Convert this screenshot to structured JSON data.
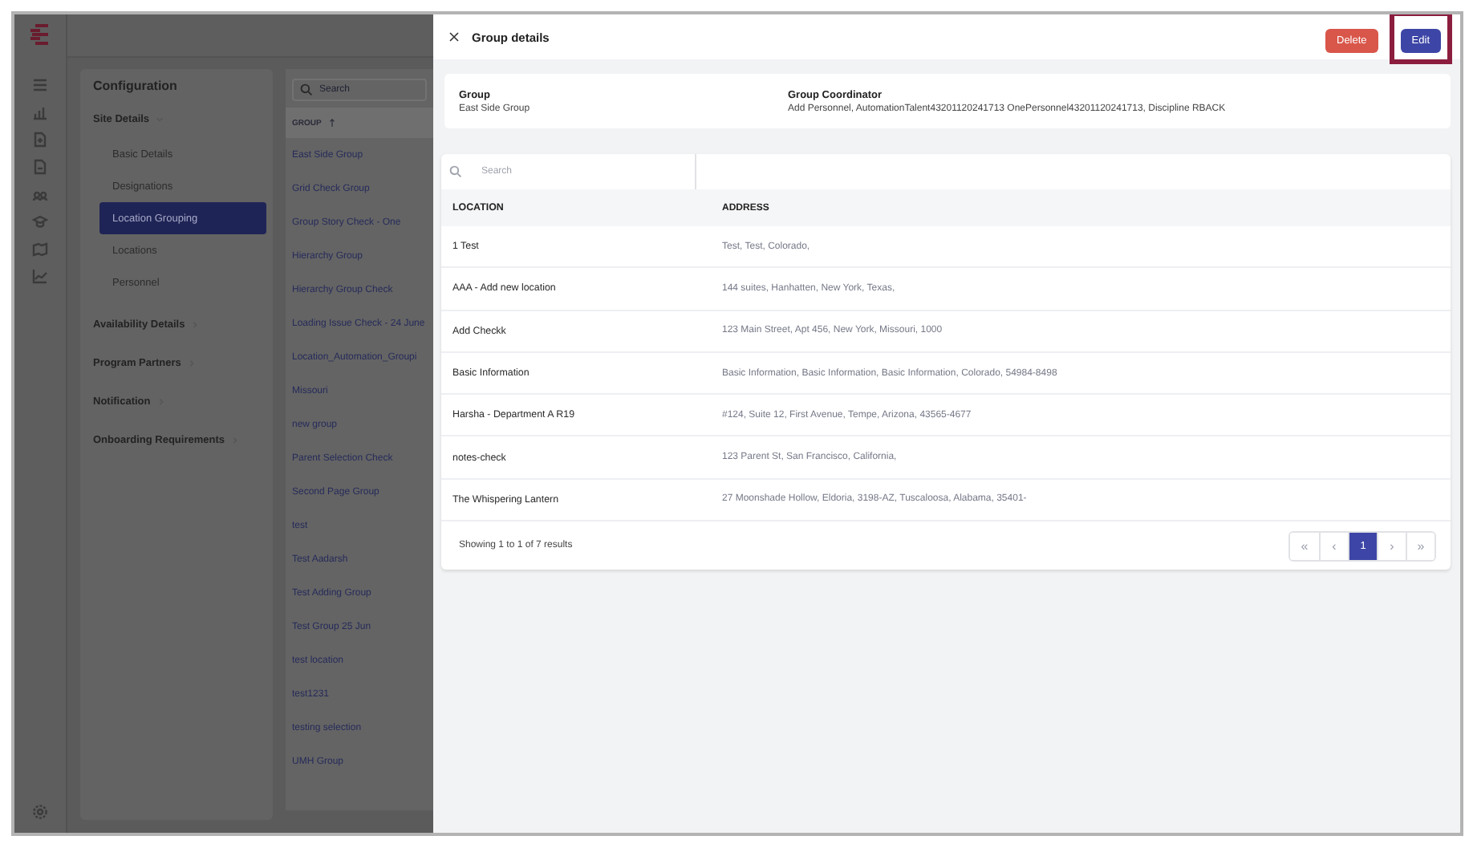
{
  "configuration": {
    "title": "Configuration",
    "sections": [
      {
        "label": "Site Details",
        "expanded": true,
        "items": [
          {
            "label": "Basic Details",
            "selected": false
          },
          {
            "label": "Designations",
            "selected": false
          },
          {
            "label": "Location Grouping",
            "selected": true
          },
          {
            "label": "Locations",
            "selected": false
          },
          {
            "label": "Personnel",
            "selected": false
          }
        ]
      },
      {
        "label": "Availability Details",
        "expanded": false
      },
      {
        "label": "Program Partners",
        "expanded": false
      },
      {
        "label": "Notification",
        "expanded": false
      },
      {
        "label": "Onboarding Requirements",
        "expanded": false
      }
    ]
  },
  "group_list": {
    "search": {
      "placeholder": "Search"
    },
    "column": "GROUP",
    "rows": [
      "East Side Group",
      "Grid Check Group",
      "Group Story Check - One",
      "Hierarchy Group",
      "Hierarchy Group Check",
      "Loading Issue Check - 24 June",
      "Location_Automation_Groupi",
      "Missouri",
      "new group",
      "Parent Selection Check",
      "Second Page Group",
      "test",
      "Test Aadarsh",
      "Test Adding Group",
      "Test Group 25 Jun",
      "test location",
      "test1231",
      "testing selection",
      "UMH Group"
    ]
  },
  "drawer": {
    "title": "Group details",
    "buttons": [
      {
        "label": "Delete",
        "kind": "danger",
        "highlighted": false
      },
      {
        "label": "Edit",
        "kind": "primary",
        "highlighted": true
      }
    ],
    "summary": [
      {
        "label": "Group",
        "value": "East Side Group"
      },
      {
        "label": "Group Coordinator",
        "value": "Add Personnel, AutomationTalent43201120241713 OnePersonnel43201120241713, Discipline RBACK"
      }
    ],
    "search": {
      "placeholder": "Search"
    },
    "table": {
      "columns": [
        "LOCATION",
        "ADDRESS"
      ],
      "rows": [
        [
          "1 Test",
          "Test, Test, Colorado,"
        ],
        [
          "AAA - Add new location",
          "144 suites, Hanhatten, New York, Texas,"
        ],
        [
          "Add Checkk",
          "123 Main Street, Apt 456, New York, Missouri, 1000"
        ],
        [
          "Basic Information",
          "Basic Information, Basic Information, Basic Information, Colorado, 54984-8498"
        ],
        [
          "Harsha - Department A R19",
          "#124, Suite 12, First Avenue, Tempe, Arizona, 43565-4677"
        ],
        [
          "notes-check",
          "123 Parent St, San Francisco, California,"
        ],
        [
          "The Whispering Lantern",
          "27 Moonshade Hollow, Eldoria, 3198-AZ, Tuscaloosa, Alabama, 35401-"
        ]
      ]
    },
    "footer": "Showing 1 to 1 of 7 results",
    "pagination": [
      {
        "label": "«",
        "kind": "nav"
      },
      {
        "label": "‹",
        "kind": "nav"
      },
      {
        "label": "1",
        "kind": "page",
        "selected": true
      },
      {
        "label": "›",
        "kind": "nav"
      },
      {
        "label": "»",
        "kind": "nav"
      }
    ]
  }
}
